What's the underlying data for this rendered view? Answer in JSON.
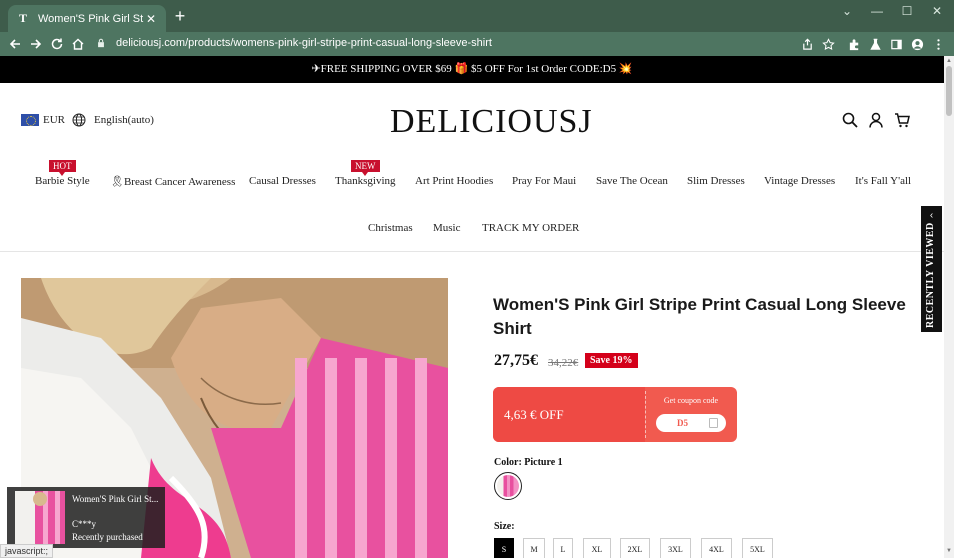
{
  "browser": {
    "tab_title": "Women'S Pink Girl Stripe Print C",
    "tab_favicon": "T",
    "tab_close": "✕",
    "new_tab": "+",
    "window_controls": {
      "chevron": "⌄",
      "minimize": "—",
      "maximize": "☐",
      "close": "✕"
    },
    "url": "deliciousj.com/products/womens-pink-girl-stripe-print-casual-long-sleeve-shirt",
    "status_text": "javascript:;"
  },
  "announcement": "✈FREE SHIPPING OVER $69 🎁 $5 OFF For 1st Order CODE:D5 💥",
  "header": {
    "currency": "EUR",
    "language": "English(auto)",
    "logo": "DELICIOUSJ"
  },
  "nav": {
    "row1": [
      {
        "label": "Barbie Style",
        "badge": "HOT"
      },
      {
        "label": "🎗Breast Cancer Awareness",
        "badge": ""
      },
      {
        "label": "Causal Dresses",
        "badge": ""
      },
      {
        "label": "Thanksgiving",
        "badge": "NEW"
      },
      {
        "label": "Art Print Hoodies",
        "badge": ""
      },
      {
        "label": "Pray For Maui",
        "badge": ""
      },
      {
        "label": "Save The Ocean",
        "badge": ""
      },
      {
        "label": "Slim Dresses",
        "badge": ""
      },
      {
        "label": "Vintage Dresses",
        "badge": ""
      },
      {
        "label": "It's Fall Y'all",
        "badge": ""
      }
    ],
    "row2": [
      {
        "label": "Christmas"
      },
      {
        "label": "Music"
      },
      {
        "label": "TRACK MY ORDER"
      }
    ]
  },
  "product": {
    "title": "Women'S Pink Girl Stripe Print Casual Long Sleeve Shirt",
    "price": "27,75€",
    "old_price": "34,22€",
    "save_label": "Save 19%",
    "coupon": {
      "amount": "4,63 € OFF",
      "label": "Get coupon code",
      "code": "D5"
    },
    "color_label": "Color: Picture 1",
    "size_label": "Size:",
    "sizes": [
      "S",
      "M",
      "L",
      "XL",
      "2XL",
      "3XL",
      "4XL",
      "5XL"
    ],
    "selected_size": "S"
  },
  "recently_viewed": {
    "label": "RECENTLY VIEWED",
    "arrow": "‹"
  },
  "toast": {
    "title": "Women'S Pink Girl St...",
    "user": "C***y",
    "status": "Recently purchased"
  },
  "colors": {
    "chrome_frame": "#3e5c4b",
    "chrome_toolbar": "#4e7561",
    "accent_red": "#d4001a",
    "coupon": "#f15a4f",
    "pink": "#e84f9f"
  }
}
